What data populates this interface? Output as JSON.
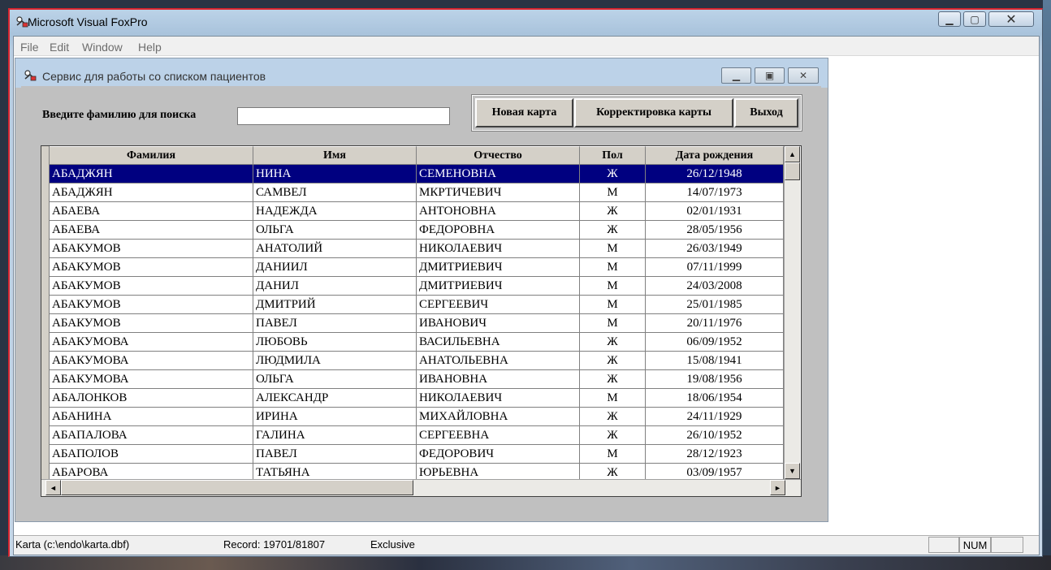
{
  "window": {
    "title": "Microsoft Visual FoxPro"
  },
  "menu": [
    {
      "label": "File"
    },
    {
      "label": "Edit"
    },
    {
      "label": "Window"
    },
    {
      "label": "Help"
    }
  ],
  "form": {
    "title": "Сервис для работы со списком пациентов",
    "search_label": "Введите фамилию для поиска",
    "search_value": "",
    "buttons": {
      "new_card": "Новая карта",
      "edit_card": "Корректировка карты",
      "exit": "Выход"
    }
  },
  "grid": {
    "columns": [
      "Фамилия",
      "Имя",
      "Отчество",
      "Пол",
      "Дата рождения"
    ],
    "selected_row": 0,
    "rows": [
      [
        "АБАДЖЯН",
        "НИНА",
        "СЕМЕНОВНА",
        "Ж",
        "26/12/1948"
      ],
      [
        "АБАДЖЯН",
        "САМВЕЛ",
        "МКРТИЧЕВИЧ",
        "М",
        "14/07/1973"
      ],
      [
        "АБАЕВА",
        "НАДЕЖДА",
        "АНТОНОВНА",
        "Ж",
        "02/01/1931"
      ],
      [
        "АБАЕВА",
        "ОЛЬГА",
        "ФЕДОРОВНА",
        "Ж",
        "28/05/1956"
      ],
      [
        "АБАКУМОВ",
        "АНАТОЛИЙ",
        "НИКОЛАЕВИЧ",
        "М",
        "26/03/1949"
      ],
      [
        "АБАКУМОВ",
        "ДАНИИЛ",
        "ДМИТРИЕВИЧ",
        "М",
        "07/11/1999"
      ],
      [
        "АБАКУМОВ",
        "ДАНИЛ",
        "ДМИТРИЕВИЧ",
        "М",
        "24/03/2008"
      ],
      [
        "АБАКУМОВ",
        "ДМИТРИЙ",
        "СЕРГЕЕВИЧ",
        "М",
        "25/01/1985"
      ],
      [
        "АБАКУМОВ",
        "ПАВЕЛ",
        "ИВАНОВИЧ",
        "М",
        "20/11/1976"
      ],
      [
        "АБАКУМОВА",
        "ЛЮБОВЬ",
        "ВАСИЛЬЕВНА",
        "Ж",
        "06/09/1952"
      ],
      [
        "АБАКУМОВА",
        "ЛЮДМИЛА",
        "АНАТОЛЬЕВНА",
        "Ж",
        "15/08/1941"
      ],
      [
        "АБАКУМОВА",
        "ОЛЬГА",
        "ИВАНОВНА",
        "Ж",
        "19/08/1956"
      ],
      [
        "АБАЛОНКОВ",
        "АЛЕКСАНДР",
        "НИКОЛАЕВИЧ",
        "М",
        "18/06/1954"
      ],
      [
        "АБАНИНА",
        "ИРИНА",
        "МИХАЙЛОВНА",
        "Ж",
        "24/11/1929"
      ],
      [
        "АБАПАЛОВА",
        "ГАЛИНА",
        "СЕРГЕЕВНА",
        "Ж",
        "26/10/1952"
      ],
      [
        "АБАПОЛОВ",
        "ПАВЕЛ",
        "ФЕДОРОВИЧ",
        "М",
        "28/12/1923"
      ],
      [
        "АБАРОВА",
        "ТАТЬЯНА",
        "ЮРЬЕВНА",
        "Ж",
        "03/09/1957"
      ]
    ]
  },
  "status": {
    "table": "Karta (c:\\endo\\karta.dbf)",
    "record": "Record: 19701/81807",
    "mode": "Exclusive",
    "num": "NUM"
  },
  "colors": {
    "selection": "#000080",
    "form_bg": "#c0c0c0",
    "titlebar": "#bcd3e8"
  },
  "icons": [
    "app-icon",
    "minimize-icon",
    "maximize-icon",
    "close-icon",
    "scroll-up-icon",
    "scroll-down-icon",
    "scroll-left-icon",
    "scroll-right-icon"
  ]
}
